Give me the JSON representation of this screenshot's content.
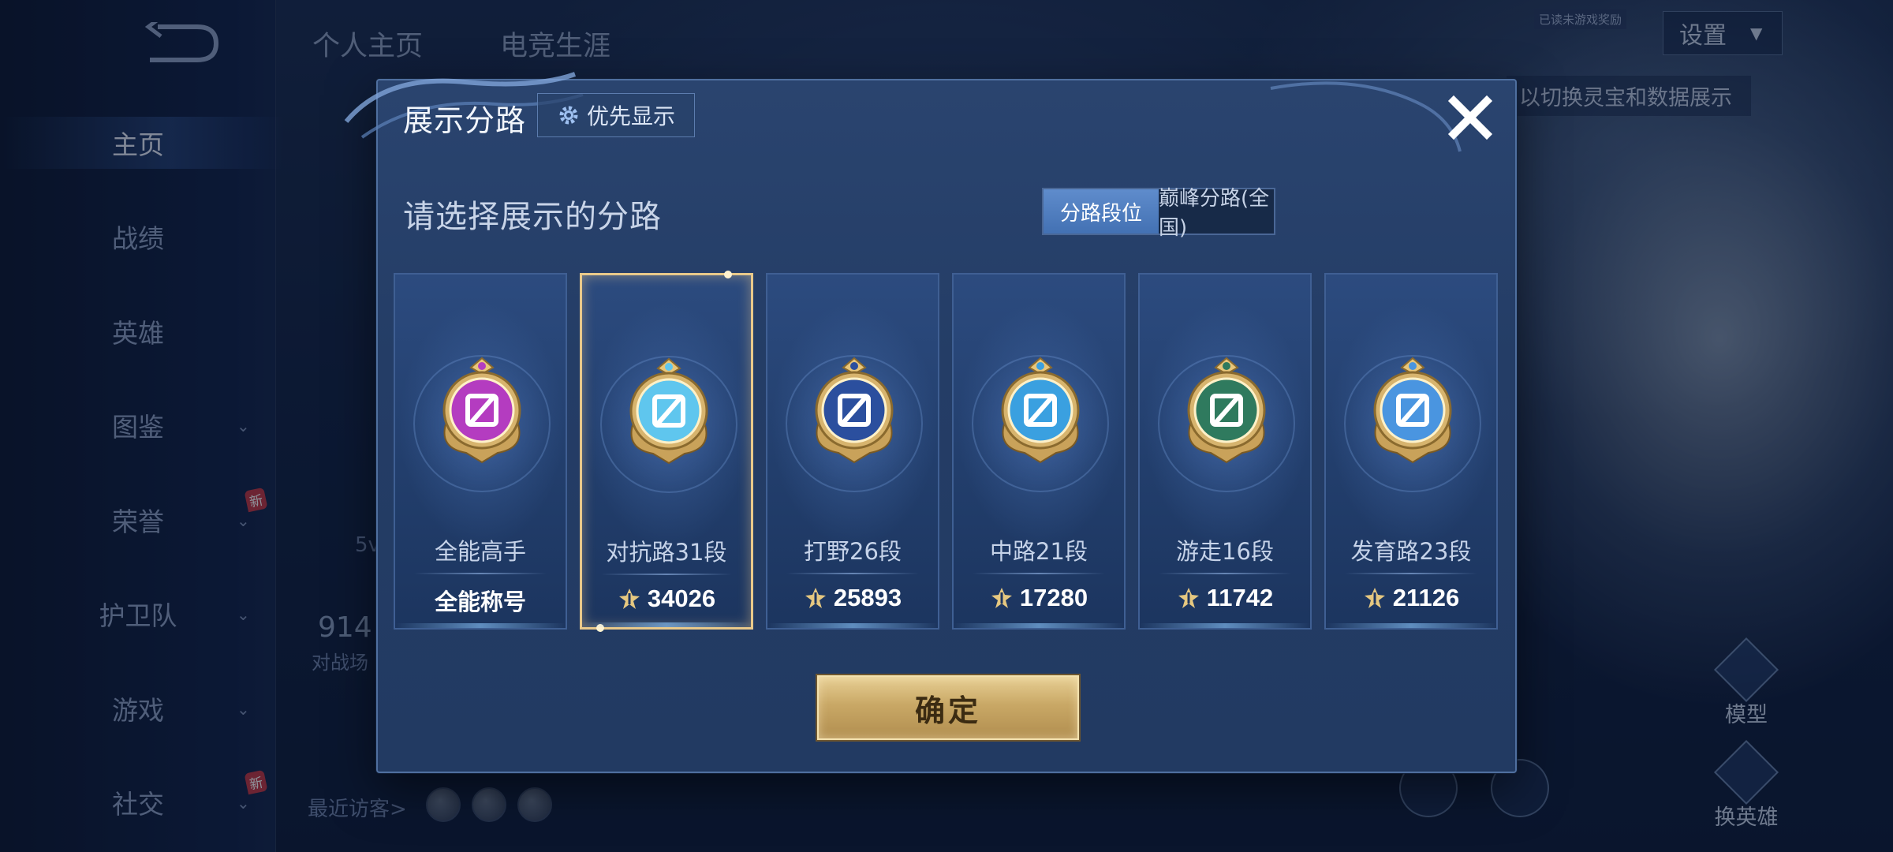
{
  "background": {
    "top_tabs": [
      "个人主页",
      "电竞生涯"
    ],
    "settings_label": "设置",
    "hint_text": "以切换灵宝和数据展示",
    "tiny_tag": "已读未游戏奖励",
    "nav_items": [
      {
        "label": "主页",
        "has_chevron": false,
        "new": false,
        "active": true
      },
      {
        "label": "战绩",
        "has_chevron": false,
        "new": false,
        "active": false
      },
      {
        "label": "英雄",
        "has_chevron": false,
        "new": false,
        "active": false
      },
      {
        "label": "图鉴",
        "has_chevron": true,
        "new": false,
        "active": false
      },
      {
        "label": "荣誉",
        "has_chevron": true,
        "new": true,
        "active": false
      },
      {
        "label": "护卫队",
        "has_chevron": true,
        "new": false,
        "active": false
      },
      {
        "label": "游戏",
        "has_chevron": true,
        "new": false,
        "active": false
      },
      {
        "label": "社交",
        "has_chevron": true,
        "new": true,
        "active": false
      }
    ],
    "new_badge": "新",
    "recent_visitors_label": "最近访客>",
    "stat_value": "914",
    "stat_sub": "对战场",
    "stat_5v": "5v",
    "side_tools": [
      "模型",
      "换英雄"
    ]
  },
  "modal": {
    "title": "展示分路",
    "priority_button": "优先显示",
    "subtitle": "请选择展示的分路",
    "toggle": {
      "options": [
        "分路段位",
        "巅峰分路(全国)"
      ],
      "selected": 0
    },
    "cards": [
      {
        "name": "全能高手",
        "value": "全能称号",
        "show_points_icon": false,
        "selected": false,
        "icon": "allround-emblem-icon",
        "color": "#b43cc0"
      },
      {
        "name": "对抗路31段",
        "value": "34026",
        "show_points_icon": true,
        "selected": true,
        "icon": "clash-lane-emblem-icon",
        "color": "#5fc6ee"
      },
      {
        "name": "打野26段",
        "value": "25893",
        "show_points_icon": true,
        "selected": false,
        "icon": "jungle-emblem-icon",
        "color": "#2b4f9e"
      },
      {
        "name": "中路21段",
        "value": "17280",
        "show_points_icon": true,
        "selected": false,
        "icon": "mid-lane-emblem-icon",
        "color": "#3aa0e0"
      },
      {
        "name": "游走16段",
        "value": "11742",
        "show_points_icon": true,
        "selected": false,
        "icon": "roam-emblem-icon",
        "color": "#2f7a5e"
      },
      {
        "name": "发育路23段",
        "value": "21126",
        "show_points_icon": true,
        "selected": false,
        "icon": "farm-lane-emblem-icon",
        "color": "#4a95e0"
      }
    ],
    "confirm_label": "确定"
  }
}
